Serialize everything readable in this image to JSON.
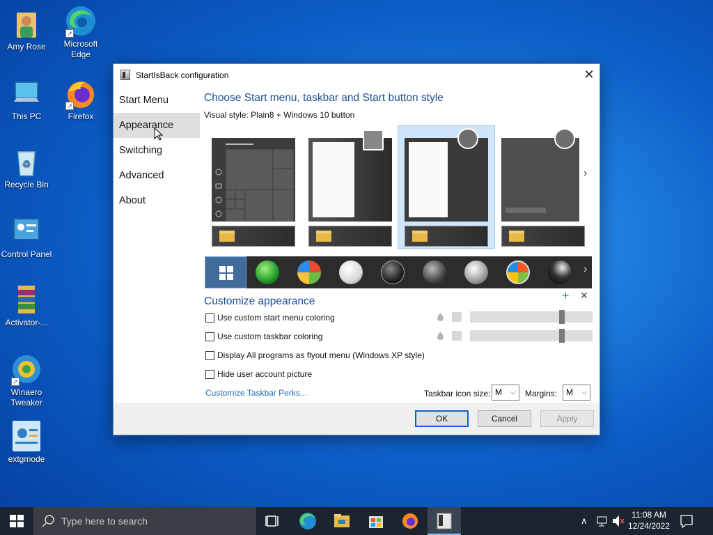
{
  "desktop": {
    "icons": [
      {
        "label": "Amy Rose"
      },
      {
        "label": "Microsoft Edge"
      },
      {
        "label": "This PC"
      },
      {
        "label": "Firefox"
      },
      {
        "label": "Recycle Bin"
      },
      {
        "label": "Control Panel"
      },
      {
        "label": "Activator-..."
      },
      {
        "label": "Winaero Tweaker"
      },
      {
        "label": "extgmode"
      }
    ]
  },
  "dialog": {
    "title": "StartIsBack configuration",
    "close_glyph": "✕",
    "nav": [
      {
        "label": "Start Menu"
      },
      {
        "label": "Appearance"
      },
      {
        "label": "Switching"
      },
      {
        "label": "Advanced"
      },
      {
        "label": "About"
      }
    ],
    "heading": "Choose Start menu, taskbar and Start button style",
    "visual_style_label": "Visual style:",
    "visual_style_value": "Plain8 + Windows 10 button",
    "customize_heading": "Customize appearance",
    "options": [
      {
        "label": "Use custom start menu coloring",
        "checked": false
      },
      {
        "label": "Use custom taskbar coloring",
        "checked": false
      },
      {
        "label": "Display All programs as flyout menu (Windows XP style)",
        "checked": false
      },
      {
        "label": "Hide user account picture",
        "checked": false
      }
    ],
    "perks_link": "Customize Taskbar Perks...",
    "icon_size_label": "Taskbar icon size:",
    "icon_size_value": "M",
    "margins_label": "Margins:",
    "margins_value": "M",
    "ok_label": "OK",
    "cancel_label": "Cancel",
    "apply_label": "Apply",
    "plus_glyph": "+",
    "x_glyph": "✕",
    "chevron_glyph": "›"
  },
  "taskbar": {
    "search_placeholder": "Type here to search",
    "time": "11:08 AM",
    "date": "12/24/2022",
    "chevron_up": "∧"
  },
  "colors": {
    "accent": "#0a64cc",
    "heading": "#1b4f96",
    "link": "#1a6bbd"
  }
}
